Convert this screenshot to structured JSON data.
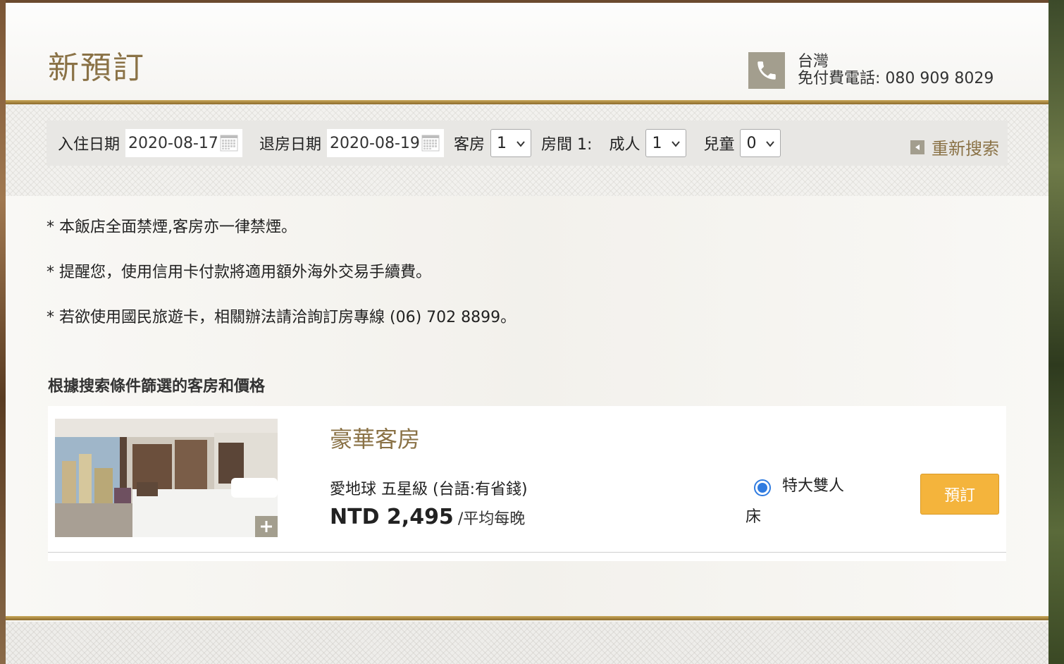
{
  "header": {
    "title": "新預訂",
    "phone_region": "台灣",
    "phone_label": "免付費電話: 080 909 8029"
  },
  "search": {
    "checkin_label": "入住日期",
    "checkin_value": "2020-08-17",
    "checkout_label": "退房日期",
    "checkout_value": "2020-08-19",
    "rooms_label": "客房",
    "rooms_value": "1",
    "room1_label": "房間 1:",
    "adults_label": "成人",
    "adults_value": "1",
    "children_label": "兒童",
    "children_value": "0",
    "reset_label": "重新搜索"
  },
  "notices": [
    "* 本飯店全面禁煙,客房亦一律禁煙。",
    "* 提醒您，使用信用卡付款將適用額外海外交易手續費。",
    "* 若欲使用國民旅遊卡，相關辦法請洽詢訂房專線 (06) 702 8899。"
  ],
  "results": {
    "section_title": "根據搜索條件篩選的客房和價格",
    "room": {
      "name": "豪華客房",
      "rate_name": "愛地球 五星級 (台語:有省錢)",
      "price": "NTD 2,495",
      "price_suffix": "/平均每晚",
      "bed_line1": "特大雙人",
      "bed_line2": "床",
      "book_label": "預訂"
    }
  },
  "colors": {
    "gold": "#8a7246",
    "button": "#f4b43c",
    "icon_bg": "#a39e8e",
    "radio": "#2f7be0"
  }
}
